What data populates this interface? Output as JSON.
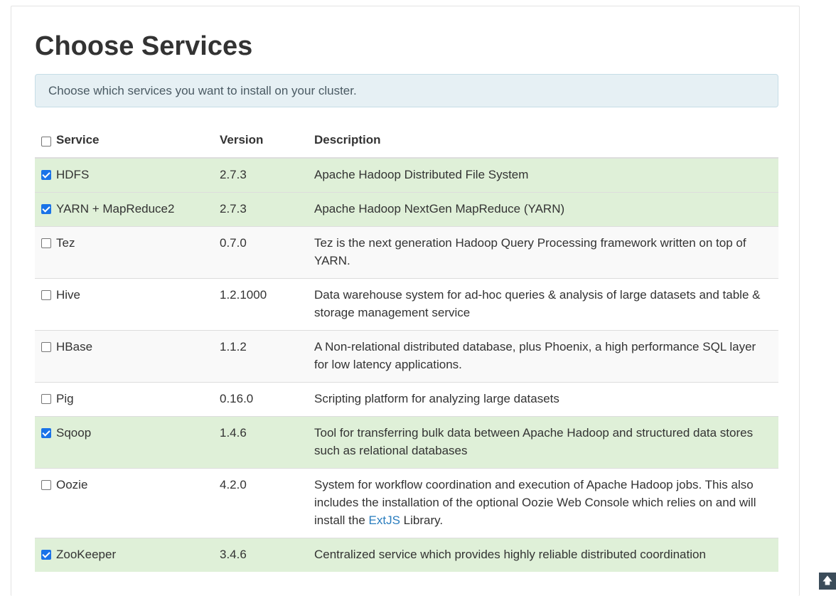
{
  "page": {
    "title": "Choose Services",
    "info": "Choose which services you want to install on your cluster."
  },
  "table": {
    "headers": {
      "service": "Service",
      "version": "Version",
      "description": "Description"
    },
    "select_all_checked": false,
    "rows": [
      {
        "service": "HDFS",
        "version": "2.7.3",
        "description": "Apache Hadoop Distributed File System",
        "checked": true
      },
      {
        "service": "YARN + MapReduce2",
        "version": "2.7.3",
        "description": "Apache Hadoop NextGen MapReduce (YARN)",
        "checked": true
      },
      {
        "service": "Tez",
        "version": "0.7.0",
        "description": "Tez is the next generation Hadoop Query Processing framework written on top of YARN.",
        "checked": false
      },
      {
        "service": "Hive",
        "version": "1.2.1000",
        "description": "Data warehouse system for ad-hoc queries & analysis of large datasets and table & storage management service",
        "checked": false
      },
      {
        "service": "HBase",
        "version": "1.1.2",
        "description": "A Non-relational distributed database, plus Phoenix, a high performance SQL layer for low latency applications.",
        "checked": false
      },
      {
        "service": "Pig",
        "version": "0.16.0",
        "description": "Scripting platform for analyzing large datasets",
        "checked": false
      },
      {
        "service": "Sqoop",
        "version": "1.4.6",
        "description": "Tool for transferring bulk data between Apache Hadoop and structured data stores such as relational databases",
        "checked": true
      },
      {
        "service": "Oozie",
        "version": "4.2.0",
        "description": "System for workflow coordination and execution of Apache Hadoop jobs. This also includes the installation of the optional Oozie Web Console which relies on and will install the ",
        "description_link": "ExtJS",
        "description_after": " Library.",
        "checked": false
      },
      {
        "service": "ZooKeeper",
        "version": "3.4.6",
        "description": "Centralized service which provides highly reliable distributed coordination",
        "checked": true
      }
    ]
  },
  "scroll_top_icon": "arrow-up-icon",
  "colors": {
    "selected_row": "#dff0d8",
    "striped_row": "#f9f9f9",
    "info_background": "#e6f0f4",
    "link": "#2a7dbe",
    "checkbox_checked": "#1a73e8"
  }
}
